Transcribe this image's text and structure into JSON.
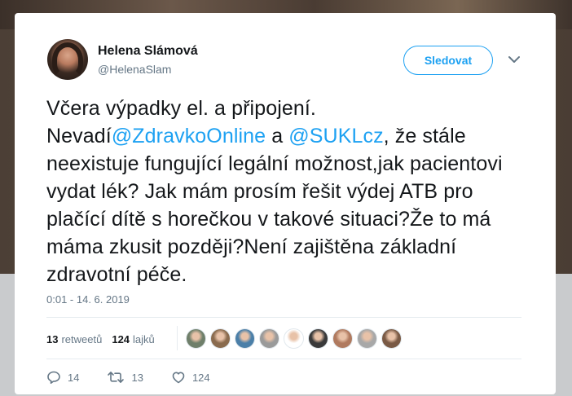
{
  "author": {
    "name": "Helena Slámová",
    "handle": "@HelenaSlam"
  },
  "follow_button": {
    "label": "Sledovat"
  },
  "tweet": {
    "line1": "Včera výpadky el. a připojení.",
    "line2_pre": "Nevadí",
    "mention1": "@ZdravkoOnline",
    "line2_mid": " a ",
    "mention2": "@SUKLcz",
    "line2_post": ", že stále",
    "rest": "neexistuje fungující legální možnost,jak pacientovi vydat lék? Jak mám prosím řešit výdej ATB pro plačící dítě s horečkou v takové situaci?Že to má máma zkusit později?Není zajištěna základní zdravotní péče.",
    "timestamp": "0:01 - 14. 6. 2019"
  },
  "stats": {
    "retweets_count": "13",
    "retweets_label": "retweetů",
    "likes_count": "124",
    "likes_label": "lajků"
  },
  "likers": [
    {
      "icon": "avatar",
      "color": "#6f7f6a"
    },
    {
      "icon": "avatar",
      "color": "#8a6b4e"
    },
    {
      "icon": "avatar",
      "color": "#4b7fa8"
    },
    {
      "icon": "avatar",
      "color": "#9a9a9a"
    },
    {
      "icon": "avatar",
      "color": "#ffffff"
    },
    {
      "icon": "avatar",
      "color": "#3a3a3a"
    },
    {
      "icon": "avatar",
      "color": "#b07a5f"
    },
    {
      "icon": "avatar",
      "color": "#a8a8a8"
    },
    {
      "icon": "avatar",
      "color": "#7a5a45"
    }
  ],
  "actions": {
    "reply_count": "14",
    "retweet_count": "13",
    "like_count": "124"
  },
  "colors": {
    "accent": "#1da1f2",
    "text": "#14171a",
    "muted": "#657786"
  }
}
